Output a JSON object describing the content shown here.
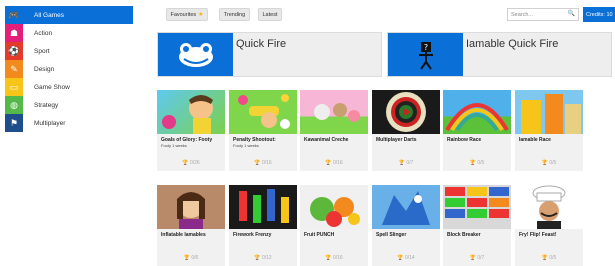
{
  "sidebar": {
    "items": [
      {
        "label": "All Games",
        "icon": "gamepad-icon",
        "color": "#0a6fd6",
        "glyph": "🎮",
        "active": true
      },
      {
        "label": "Action",
        "icon": "ghost-icon",
        "color": "#e2207a",
        "glyph": "☗",
        "active": false
      },
      {
        "label": "Sport",
        "icon": "ball-icon",
        "color": "#e33a2a",
        "glyph": "⚽",
        "active": false
      },
      {
        "label": "Design",
        "icon": "design-icon",
        "color": "#f28a1e",
        "glyph": "✎",
        "active": false
      },
      {
        "label": "Game Show",
        "icon": "gameshow-icon",
        "color": "#f7c41a",
        "glyph": "▭",
        "active": false
      },
      {
        "label": "Strategy",
        "icon": "globe-icon",
        "color": "#54b948",
        "glyph": "◍",
        "active": false
      },
      {
        "label": "Multiplayer",
        "icon": "multiplayer-icon",
        "color": "#1f4e8c",
        "glyph": "⚑",
        "active": false
      }
    ]
  },
  "topbar": {
    "favourites_label": "Favourites",
    "favourites_star": "★",
    "trending_label": "Trending",
    "latest_label": "Latest",
    "search_placeholder": "Search...",
    "search_icon": "🔍",
    "credits_label": "Credits: 10"
  },
  "featured": [
    {
      "title": "Quick Fire",
      "icon": "frog-icon"
    },
    {
      "title": "Iamable Quick Fire",
      "icon": "stickman-question-icon"
    }
  ],
  "games_row1": [
    {
      "title": "Goals of Glory: Footy",
      "subtitle": "Footy 1 weeks",
      "stat": "0/26"
    },
    {
      "title": "Penalty Shootout:",
      "subtitle": "Footy 1 weeks",
      "stat": "0/16"
    },
    {
      "title": "Kawanimal Creche",
      "subtitle": "",
      "stat": "0/16"
    },
    {
      "title": "Multiplayer Darts",
      "subtitle": "",
      "stat": "0/7"
    },
    {
      "title": "Rainbow Race",
      "subtitle": "",
      "stat": "0/5"
    },
    {
      "title": "Iamable Race",
      "subtitle": "",
      "stat": "0/5"
    }
  ],
  "games_row2": [
    {
      "title": "Inflatable Iamables",
      "subtitle": "",
      "stat": "0/6"
    },
    {
      "title": "Firework Frenzy",
      "subtitle": "",
      "stat": "0/12"
    },
    {
      "title": "Fruit PUNCH",
      "subtitle": "",
      "stat": "0/16"
    },
    {
      "title": "Spell Slinger",
      "subtitle": "",
      "stat": "0/14"
    },
    {
      "title": "Block Breaker",
      "subtitle": "",
      "stat": "0/7"
    },
    {
      "title": "Fry! Flip! Feast!",
      "subtitle": "",
      "stat": "0/5"
    }
  ],
  "trophy_glyph": "🏆"
}
